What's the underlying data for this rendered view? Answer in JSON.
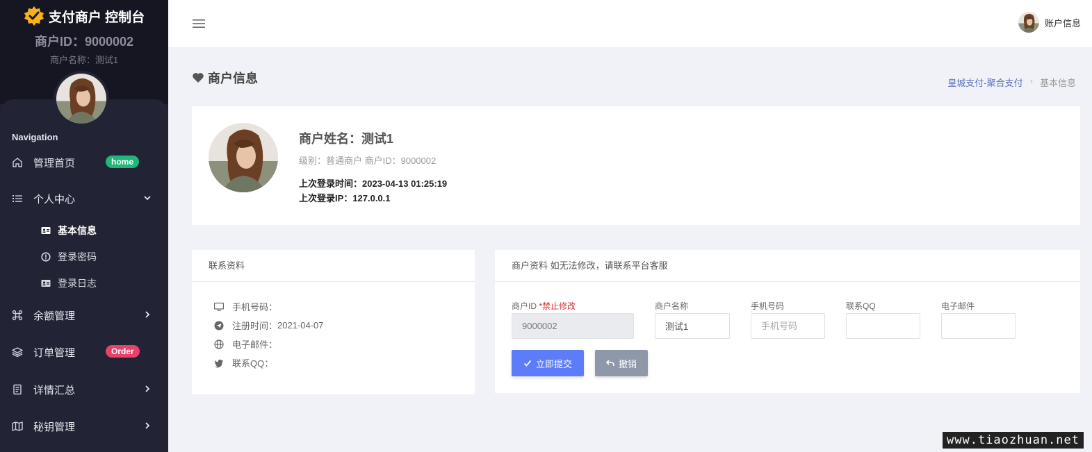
{
  "sidebar": {
    "brand_title": "支付商户 控制台",
    "merchant_id": "商户ID：9000002",
    "merchant_name": "商户名称：测试1",
    "nav_title": "Navigation",
    "items": [
      {
        "label": "管理首页",
        "badge": "home",
        "badge_color": "#21b67a"
      },
      {
        "label": "个人中心"
      },
      {
        "label": "余额管理"
      },
      {
        "label": "订单管理",
        "badge": "Order",
        "badge_color": "#e8416a"
      },
      {
        "label": "详情汇总"
      },
      {
        "label": "秘钥管理"
      }
    ],
    "sub_items": [
      {
        "label": "基本信息"
      },
      {
        "label": "登录密码"
      },
      {
        "label": "登录日志"
      }
    ]
  },
  "topbar": {
    "account_label": "账户信息"
  },
  "page": {
    "title": "商户信息",
    "breadcrumb": [
      "皇城支付-聚合支付",
      "基本信息"
    ]
  },
  "profile": {
    "name": "商户姓名：测试1",
    "level": "级别：普通商户 商户ID：9000002",
    "last_login_time": "上次登录时间：2023-04-13 01:25:19",
    "last_login_ip": "上次登录IP：127.0.0.1"
  },
  "contact": {
    "header": "联系资料",
    "rows": [
      {
        "label": "手机号码：",
        "value": "",
        "icon": "monitor-icon"
      },
      {
        "label": "注册时间：",
        "value": "2021-04-07",
        "icon": "send-icon"
      },
      {
        "label": "电子邮件：",
        "value": "",
        "icon": "globe-icon"
      },
      {
        "label": "联系QQ：",
        "value": "",
        "icon": "twitter-icon"
      }
    ]
  },
  "merchant_form": {
    "header": "商户资料 如无法修改，请联系平台客服",
    "fields": [
      {
        "label": "商户ID",
        "warning": "*禁止修改",
        "value": "9000002",
        "placeholder": ""
      },
      {
        "label": "商户名称",
        "value": "测试1",
        "placeholder": ""
      },
      {
        "label": "手机号码",
        "value": "",
        "placeholder": "手机号码"
      },
      {
        "label": "联系QQ",
        "value": "",
        "placeholder": ""
      },
      {
        "label": "电子邮件",
        "value": "",
        "placeholder": ""
      }
    ],
    "submit_label": "立即提交",
    "cancel_label": "撤销"
  },
  "watermark": "www.tiaozhuan.net",
  "colors": {
    "accent": "#5c7cfa",
    "sidebar_bg": "#222334",
    "page_bg": "#f1f2f7"
  }
}
